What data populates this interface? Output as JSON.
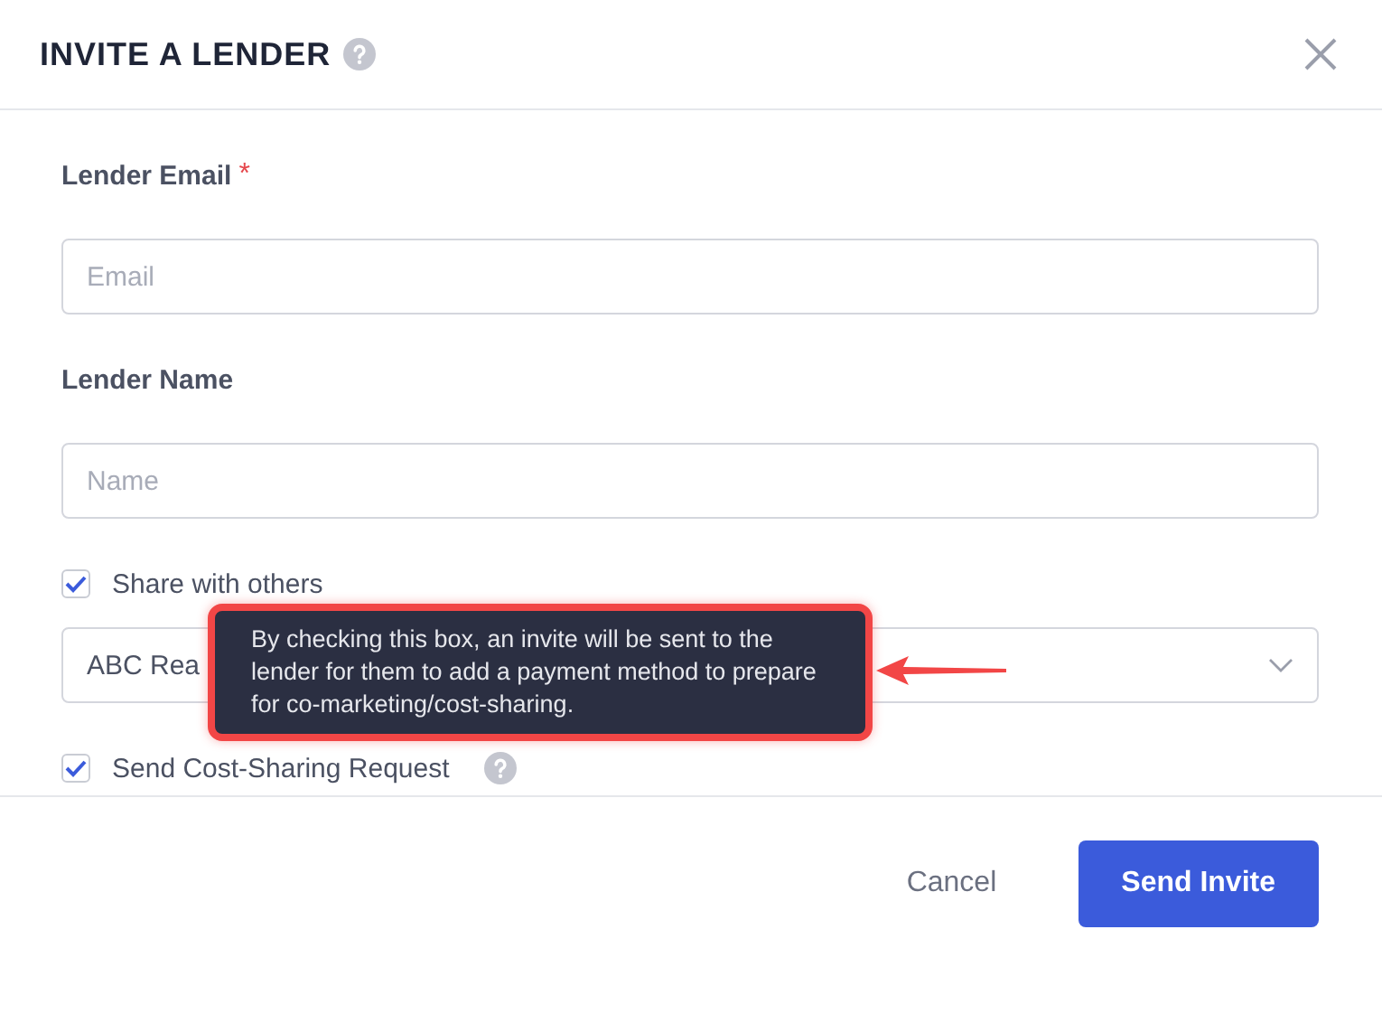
{
  "dialog": {
    "title": "INVITE A LENDER"
  },
  "fields": [
    {
      "label": "Lender Email",
      "required": true,
      "required_mark": "*",
      "placeholder": "Email"
    },
    {
      "label": "Lender Name",
      "required": false,
      "placeholder": "Name"
    }
  ],
  "share": {
    "label": "Share with others",
    "checked": true
  },
  "select": {
    "value": "ABC Rea"
  },
  "cost_sharing": {
    "label": "Send Cost-Sharing Request",
    "checked": true
  },
  "tooltip": {
    "text": "By checking this box, an invite will be sent to the lender for them to add a payment method to prepare for co-marketing/cost-sharing."
  },
  "buttons": [
    {
      "label": "Cancel",
      "kind": "secondary"
    },
    {
      "label": "Send Invite",
      "kind": "primary"
    }
  ]
}
